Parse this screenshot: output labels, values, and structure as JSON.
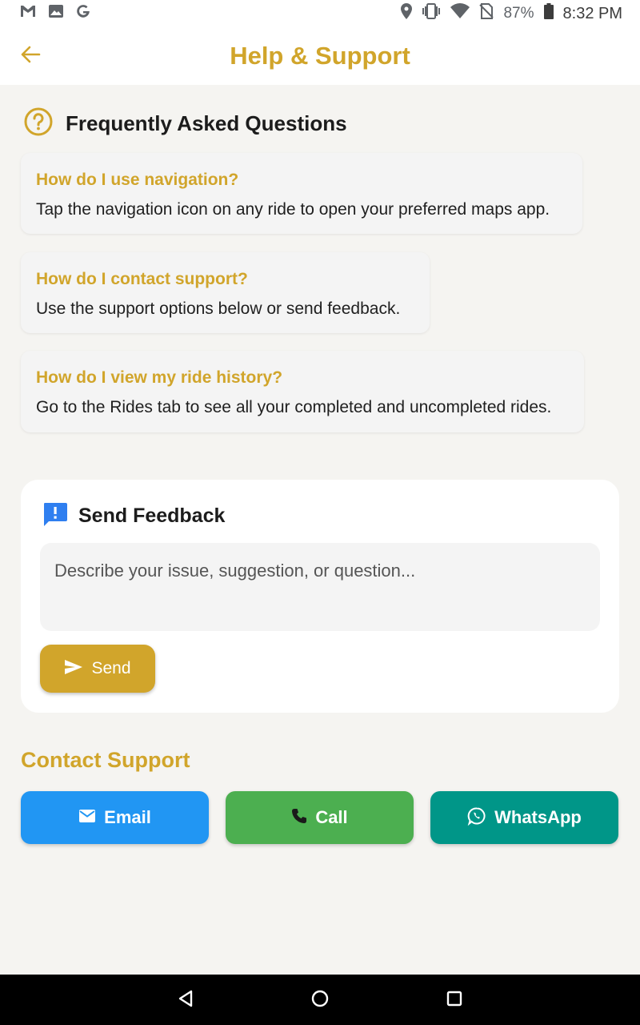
{
  "status_bar": {
    "left_icons": [
      "gmail-icon",
      "image-icon",
      "google-icon"
    ],
    "right_icons": [
      "location-icon",
      "vibrate-icon",
      "wifi-icon",
      "no-sim-icon",
      "battery-icon"
    ],
    "battery_percent": "87%",
    "time": "8:32 PM"
  },
  "app_bar": {
    "title": "Help & Support",
    "back_icon": "arrow-back-icon"
  },
  "faq": {
    "title": "Frequently Asked Questions",
    "icon": "help-circle-icon",
    "items": [
      {
        "question": "How do I use navigation?",
        "answer": "Tap the navigation icon on any ride to open your preferred maps app."
      },
      {
        "question": "How do I contact support?",
        "answer": "Use the support options below or send feedback."
      },
      {
        "question": "How do I view my ride history?",
        "answer": "Go to the Rides tab to see all your completed and uncompleted rides."
      }
    ]
  },
  "feedback": {
    "title": "Send Feedback",
    "icon": "feedback-icon",
    "placeholder": "Describe your issue, suggestion, or question...",
    "value": "",
    "send_label": "Send"
  },
  "contact": {
    "title": "Contact Support",
    "buttons": [
      {
        "label": "Email",
        "icon": "email-icon",
        "color": "#2196f3"
      },
      {
        "label": "Call",
        "icon": "phone-icon",
        "color": "#4caf50"
      },
      {
        "label": "WhatsApp",
        "icon": "whatsapp-icon",
        "color": "#009688"
      }
    ]
  },
  "colors": {
    "accent": "#d1a52b",
    "background": "#f5f4f1",
    "card": "#f4f4f4"
  }
}
